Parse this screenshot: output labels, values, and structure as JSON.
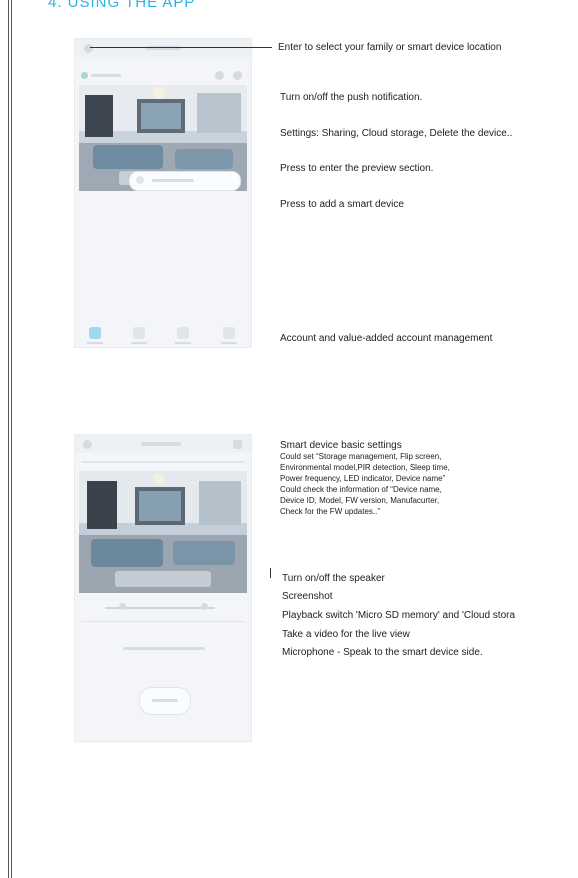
{
  "heading": "4. USING THE APP",
  "colors": {
    "heading": "#2ab3e8",
    "phone_bg": "#f3f5f8",
    "accent": "#9fd8ef"
  },
  "section1": {
    "callouts": [
      "Enter to select your family or smart device location",
      "Turn on/off the push notification.",
      "Settings: Sharing, Cloud storage, Delete the device..",
      "Press to enter the preview section.",
      "Press to add a smart device",
      "Account and value-added account management"
    ]
  },
  "section2": {
    "settings_title": "Smart device basic settings",
    "settings_lines": [
      "Could set “Storage management, Flip screen,",
      "Environmental model,PIR detection, Sleep time,",
      "Power frequency, LED indicator, Device name”",
      "Could check the information of “Device name,",
      "Device ID, Model, FW version, Manufacurter,",
      "Check for the FW updates..”"
    ],
    "callouts": [
      "Turn on/off the speaker",
      "Screenshot",
      "Playback switch 'Micro SD memory' and 'Cloud stora",
      "Take a video for the live view",
      "Microphone - Speak to the smart device side."
    ]
  }
}
